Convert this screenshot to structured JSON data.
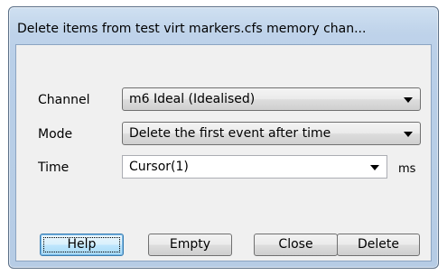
{
  "window": {
    "title": "Delete items from test virt markers.cfs memory chan..."
  },
  "form": {
    "channel": {
      "label": "Channel",
      "value": "m6 Ideal (Idealised)"
    },
    "mode": {
      "label": "Mode",
      "value": "Delete the first event after time"
    },
    "time": {
      "label": "Time",
      "value": "Cursor(1)",
      "unit": "ms"
    }
  },
  "buttons": {
    "help": "Help",
    "empty": "Empty",
    "close": "Close",
    "delete": "Delete"
  },
  "icons": {
    "dropdown_arrow": "chevron-down-icon"
  }
}
